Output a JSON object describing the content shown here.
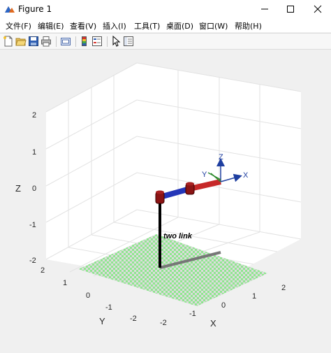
{
  "window": {
    "title": "Figure 1"
  },
  "menu": {
    "items": [
      {
        "label": "文件(F)"
      },
      {
        "label": "编辑(E)"
      },
      {
        "label": "查看(V)"
      },
      {
        "label": "插入(I)"
      },
      {
        "label": "工具(T)"
      },
      {
        "label": "桌面(D)"
      },
      {
        "label": "窗口(W)"
      },
      {
        "label": "帮助(H)"
      }
    ]
  },
  "toolbar": {
    "icons": [
      "new-figure-icon",
      "open-file-icon",
      "save-icon",
      "print-icon",
      "link-plot-icon",
      "colorbar-icon",
      "legend-icon",
      "edit-plot-pointer-icon",
      "property-inspector-icon"
    ]
  },
  "plot": {
    "xlabel": "X",
    "ylabel": "Y",
    "zlabel": "Z",
    "z_ticks": [
      "2",
      "1",
      "0",
      "-1",
      "-2"
    ],
    "x_ticks": [
      "-2",
      "-1",
      "0",
      "1",
      "2"
    ],
    "y_ticks": [
      "2",
      "1",
      "0",
      "-1",
      "-2"
    ],
    "robot_name": "two link",
    "frame_labels": {
      "x": "X",
      "y": "Y",
      "z": "Z"
    },
    "colors": {
      "floor_green": "#8fe68f",
      "floor_light": "#dcdcdc",
      "link1": "#2436b8",
      "link2": "#c62828",
      "joint": "#8b1414",
      "axis_x": "#1f3fa0",
      "axis_z": "#1f3fa0"
    }
  }
}
